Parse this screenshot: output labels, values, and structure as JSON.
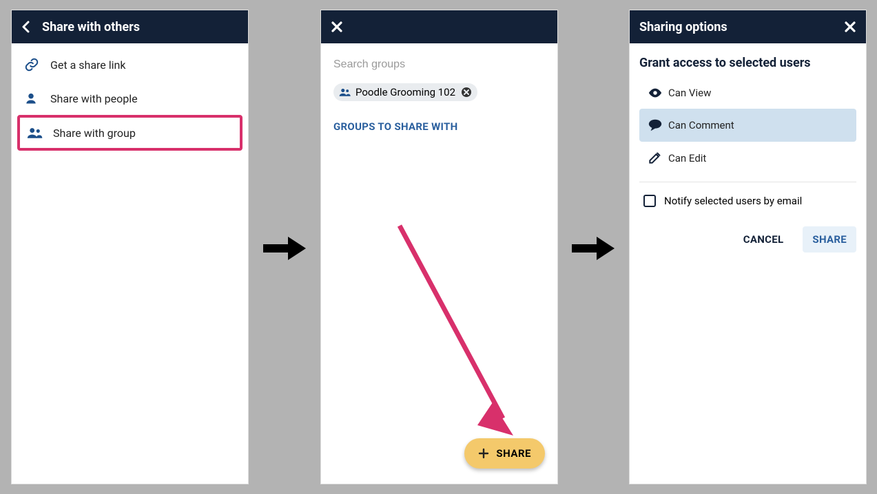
{
  "panel1": {
    "title": "Share with others",
    "items": [
      {
        "label": "Get a share link"
      },
      {
        "label": "Share with people"
      },
      {
        "label": "Share with group"
      }
    ]
  },
  "panel2": {
    "searchPlaceholder": "Search groups",
    "selectedGroup": "Poodle Grooming 102",
    "sectionLabel": "GROUPS TO SHARE WITH",
    "fabLabel": "SHARE"
  },
  "panel3": {
    "title": "Sharing options",
    "grantTitle": "Grant access to selected users",
    "options": [
      {
        "label": "Can View"
      },
      {
        "label": "Can Comment"
      },
      {
        "label": "Can Edit"
      }
    ],
    "notifyLabel": "Notify selected users by email",
    "cancelLabel": "CANCEL",
    "shareLabel": "SHARE"
  }
}
